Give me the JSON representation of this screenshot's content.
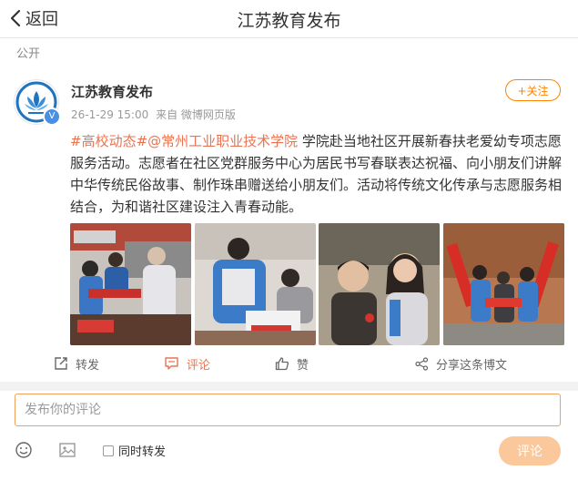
{
  "nav": {
    "back_label": "返回",
    "title": "江苏教育发布"
  },
  "post": {
    "visibility": "公开",
    "author": "江苏教育发布",
    "timestamp": "26-1-29 15:00",
    "source": "来自 微博网页版",
    "follow_label": "+关注",
    "tag_topic": "#高校动态#",
    "tag_mention": "@常州工业职业技术学院",
    "body": " 学院赴当地社区开展新春扶老爱幼专项志愿服务活动。志愿者在社区党群服务中心为居民书写春联表达祝福、向小朋友们讲解中华传统民俗故事、制作珠串赠送给小朋友们。活动将传统文化传承与志愿服务相结合，为和谐社区建设注入青春动能。",
    "photos": [
      "photo-1",
      "photo-2",
      "photo-3",
      "photo-4"
    ]
  },
  "actions": {
    "repost": "转发",
    "comment": "评论",
    "like": "赞",
    "share": "分享这条博文"
  },
  "composer": {
    "placeholder": "发布你的评论",
    "repost_option": "同时转发",
    "submit_label": "评论"
  },
  "colors": {
    "accent": "#ff8200",
    "link": "#eb7350",
    "submit_disabled": "#fbc89b"
  }
}
